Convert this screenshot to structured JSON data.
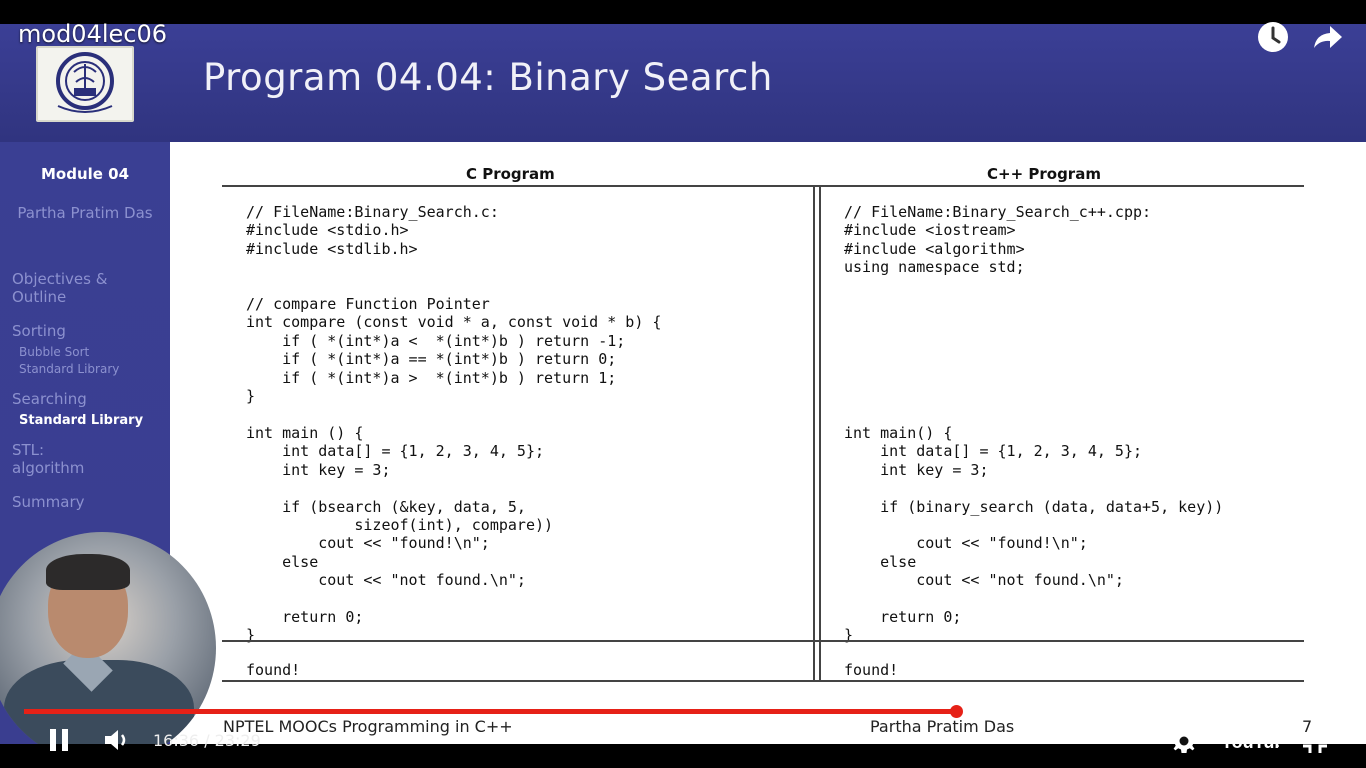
{
  "video": {
    "title": "mod04lec06",
    "time_current": "16:36",
    "time_separator": " / ",
    "time_total": "23:29",
    "progress": 0.7069,
    "youtube_label": "YouTube",
    "accent_color": "#e62117"
  },
  "slide": {
    "title": "Program 04.04: Binary Search",
    "sidebar": {
      "module": "Module 04",
      "author": "Partha Pratim Das",
      "items": [
        "Objectives & Outline",
        "Sorting",
        "Bubble Sort",
        "Standard Library",
        "Searching",
        "Standard Library",
        "STL: algorithm",
        "Summary"
      ]
    },
    "c_program": {
      "heading": "C Program",
      "code": "// FileName:Binary_Search.c:\n#include <stdio.h>\n#include <stdlib.h>\n\n\n// compare Function Pointer\nint compare (const void * a, const void * b) {\n    if ( *(int*)a <  *(int*)b ) return -1;\n    if ( *(int*)a == *(int*)b ) return 0;\n    if ( *(int*)a >  *(int*)b ) return 1;\n}\n\nint main () {\n    int data[] = {1, 2, 3, 4, 5};\n    int key = 3;\n\n    if (bsearch (&key, data, 5,\n            sizeof(int), compare))\n        cout << \"found!\\n\";\n    else\n        cout << \"not found.\\n\";\n\n    return 0;\n}",
      "output": "found!"
    },
    "cpp_program": {
      "heading": "C++ Program",
      "code": "// FileName:Binary_Search_c++.cpp:\n#include <iostream>\n#include <algorithm>\nusing namespace std;\n\n\n\n\n\n\n\n\nint main() {\n    int data[] = {1, 2, 3, 4, 5};\n    int key = 3;\n\n    if (binary_search (data, data+5, key))\n\n        cout << \"found!\\n\";\n    else\n        cout << \"not found.\\n\";\n\n    return 0;\n}",
      "output": "found!"
    },
    "footer": {
      "course": "NPTEL MOOCs Programming in C++",
      "author": "Partha Pratim Das",
      "page": "7"
    }
  }
}
